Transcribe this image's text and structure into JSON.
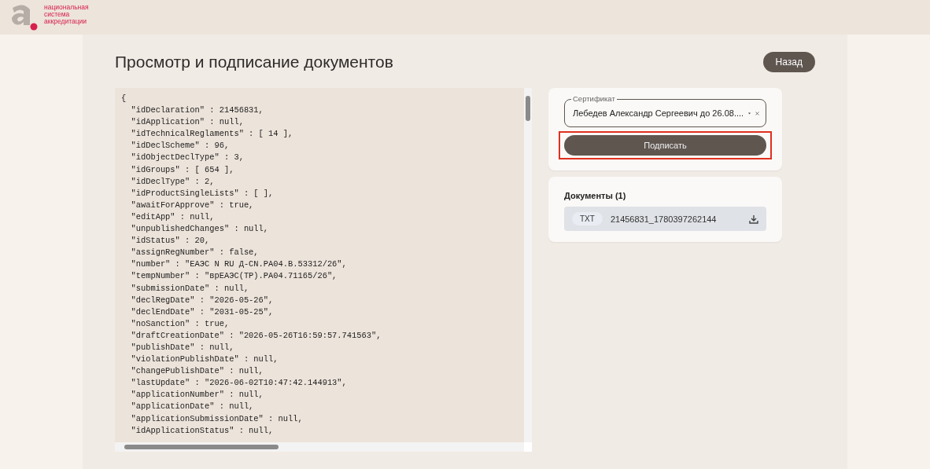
{
  "header": {
    "logo_text": "национальная система аккредитации"
  },
  "page": {
    "title": "Просмотр и подписание документов",
    "back_button": "Назад"
  },
  "code_view": {
    "lines": [
      "{",
      "  \"idDeclaration\" : 21456831,",
      "  \"idApplication\" : null,",
      "  \"idTechnicalReglaments\" : [ 14 ],",
      "  \"idDeclScheme\" : 96,",
      "  \"idObjectDeclType\" : 3,",
      "  \"idGroups\" : [ 654 ],",
      "  \"idDeclType\" : 2,",
      "  \"idProductSingleLists\" : [ ],",
      "  \"awaitForApprove\" : true,",
      "  \"editApp\" : null,",
      "  \"unpublishedChanges\" : null,",
      "  \"idStatus\" : 20,",
      "  \"assignRegNumber\" : false,",
      "  \"number\" : \"ЕАЭС N RU Д-CN.РА04.В.53312/26\",",
      "  \"tempNumber\" : \"врЕАЭС(ТР).РА04.71165/26\",",
      "  \"submissionDate\" : null,",
      "  \"declRegDate\" : \"2026-05-26\",",
      "  \"declEndDate\" : \"2031-05-25\",",
      "  \"noSanction\" : true,",
      "  \"draftCreationDate\" : \"2026-05-26T16:59:57.741563\",",
      "  \"publishDate\" : null,",
      "  \"violationPublishDate\" : null,",
      "  \"changePublishDate\" : null,",
      "  \"lastUpdate\" : \"2026-06-02T10:47:42.144913\",",
      "  \"applicationNumber\" : null,",
      "  \"applicationDate\" : null,",
      "  \"applicationSubmissionDate\" : null,",
      "  \"idApplicationStatus\" : null,"
    ]
  },
  "signing": {
    "certificate": {
      "label": "Сертификат",
      "value": "Лебедев Александр Сергеевич до 26.08...."
    },
    "sign_button": {
      "label": "Подписать",
      "highlighted": true
    }
  },
  "documents": {
    "title": "Документы (1)",
    "items": [
      {
        "type": "TXT",
        "name": "21456831_1780397262144"
      }
    ]
  }
}
